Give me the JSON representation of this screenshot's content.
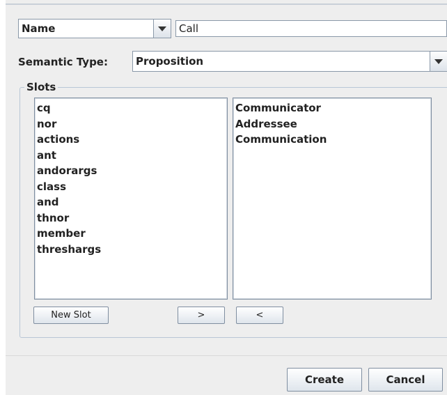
{
  "filter": {
    "field_selected": "Name",
    "search_value": "Call"
  },
  "semantic_type": {
    "label": "Semantic Type:",
    "selected": "Proposition"
  },
  "slots": {
    "title": "Slots",
    "available": [
      "cq",
      "nor",
      "actions",
      "ant",
      "andorargs",
      "class",
      "and",
      "thnor",
      "member",
      "threshargs"
    ],
    "selected": [
      "Communicator",
      "Addressee",
      "Communication"
    ],
    "new_slot_label": "New Slot",
    "move_right_label": ">",
    "move_left_label": "<"
  },
  "footer": {
    "create_label": "Create",
    "cancel_label": "Cancel"
  }
}
